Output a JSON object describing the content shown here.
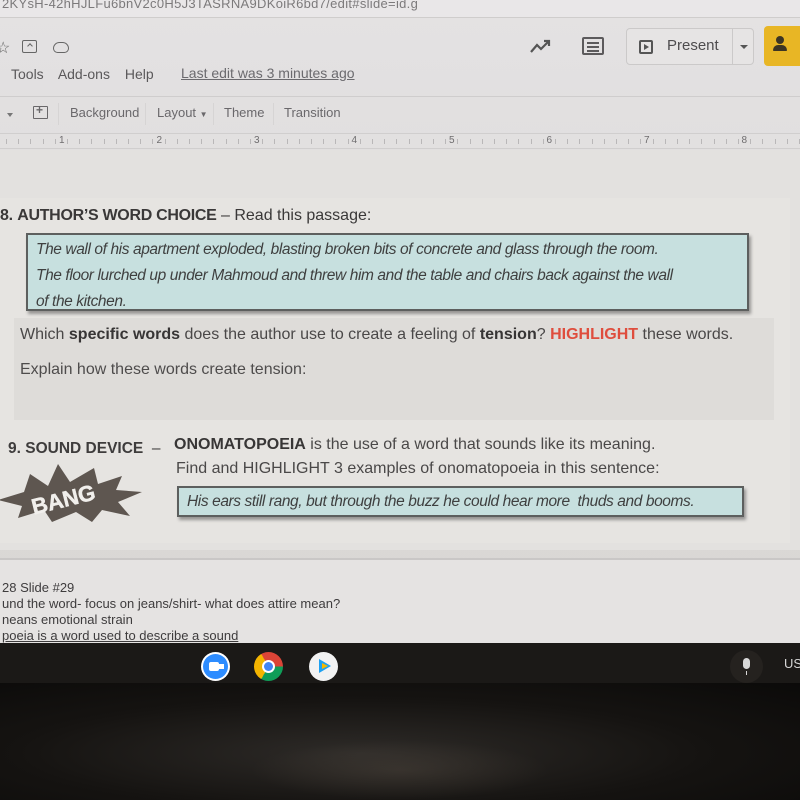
{
  "browser": {
    "url_fragment": "2KYsH-42hHJLFu6bnV2c0H5J3TASRNA9DKoiR6bd7/edit#slide=id.g"
  },
  "app_header": {
    "menus": [
      "Tools",
      "Add-ons",
      "Help"
    ],
    "last_edit": "Last edit was 3 minutes ago",
    "present_label": "Present",
    "icons": [
      "star-icon",
      "move-to-folder-icon",
      "cloud-saved-icon",
      "activity-trend-icon",
      "comments-icon",
      "share-icon"
    ]
  },
  "toolbar": {
    "background_label": "Background",
    "layout_label": "Layout",
    "theme_label": "Theme",
    "transition_label": "Transition"
  },
  "ruler": {
    "numbers": [
      "1",
      "2",
      "3",
      "4",
      "5",
      "6",
      "7",
      "8"
    ]
  },
  "slide": {
    "q8": {
      "number": "8.",
      "title": "AUTHOR’S WORD CHOICE",
      "dash": " – ",
      "intro": "Read this passage:",
      "passage_lines": [
        "The wall of his apartment exploded, blasting broken bits of concrete and glass through the room.",
        "The floor lurched up under Mahmoud and threw him and the table and chairs back against the wall",
        "of the kitchen."
      ],
      "prompt_part1": "Which ",
      "prompt_bold1": "specific words",
      "prompt_part2": " does the author use to create a feeling of ",
      "prompt_bold2": "tension",
      "prompt_part3": "? ",
      "prompt_highlight": "HIGHLIGHT",
      "prompt_part4": " these words.",
      "explain": "Explain how these words create tension:"
    },
    "q9": {
      "number": "9.",
      "title": "SOUND DEVICE",
      "dash": "  –  ",
      "term": "ONOMATOPOEIA",
      "definition": " is the use of a word that sounds like its meaning.",
      "instruction": "Find and HIGHLIGHT 3 examples of onomatopoeia in this sentence:",
      "sentence": "His ears still rang, but through the buzz he could hear more  thuds and booms.",
      "graphic_text": "BANG"
    },
    "highlight_color": "#df4d3d",
    "passage_bg": "#c7e0df"
  },
  "speaker_notes": [
    "28 Slide #29",
    "und the word- focus on jeans/shirt- what does attire mean?",
    "neans emotional strain",
    "poeia is a word used to describe a sound"
  ],
  "shelf": {
    "apps": [
      "Zoom",
      "Chrome",
      "Play Store"
    ],
    "ime_label": "US"
  }
}
